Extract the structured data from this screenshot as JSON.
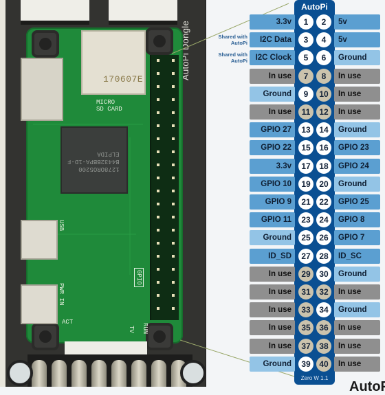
{
  "photo": {
    "dongle_label": "AutoPi Dongle",
    "sd_card_code": "170607E",
    "silkscreen": {
      "micro_sd": "MICRO\nSD CARD",
      "usb": "USB",
      "pwr_in": "PWR IN",
      "act": "ACT",
      "gpio": "GPIO",
      "tv": "TV",
      "run": "RUN",
      "soc_text": "1278ORO5200\nB4432BBPA-1D-F\nELPIDA"
    }
  },
  "pinout": {
    "title": "AutoPi",
    "footer": "Zero W 1.1",
    "shared_note": "Shared with AutoPi",
    "colors": {
      "column": "#0a4f92",
      "label_mid": "#5b9fd1",
      "label_light": "#93c4e6",
      "label_in_use": "#8f8f8f",
      "pin_free": "#ffffff",
      "pin_in_use": "#cbc3ad"
    },
    "rows": [
      {
        "left": {
          "pin": 1,
          "label": "3.3v",
          "style": "mid",
          "pin_style": "white"
        },
        "right": {
          "pin": 2,
          "label": "5v",
          "style": "mid",
          "pin_style": "white"
        },
        "note": ""
      },
      {
        "left": {
          "pin": 3,
          "label": "I2C Data",
          "style": "mid",
          "pin_style": "white"
        },
        "right": {
          "pin": 4,
          "label": "5v",
          "style": "mid",
          "pin_style": "white"
        },
        "note": "Shared with AutoPi"
      },
      {
        "left": {
          "pin": 5,
          "label": "I2C Clock",
          "style": "mid",
          "pin_style": "white"
        },
        "right": {
          "pin": 6,
          "label": "Ground",
          "style": "light",
          "pin_style": "white"
        },
        "note": "Shared with AutoPi"
      },
      {
        "left": {
          "pin": 7,
          "label": "In use",
          "style": "gray",
          "pin_style": "tan"
        },
        "right": {
          "pin": 8,
          "label": "In use",
          "style": "gray",
          "pin_style": "tan"
        },
        "note": ""
      },
      {
        "left": {
          "pin": 9,
          "label": "Ground",
          "style": "light",
          "pin_style": "white"
        },
        "right": {
          "pin": 10,
          "label": "In use",
          "style": "gray",
          "pin_style": "tan"
        },
        "note": ""
      },
      {
        "left": {
          "pin": 11,
          "label": "In use",
          "style": "gray",
          "pin_style": "tan"
        },
        "right": {
          "pin": 12,
          "label": "In use",
          "style": "gray",
          "pin_style": "tan"
        },
        "note": ""
      },
      {
        "left": {
          "pin": 13,
          "label": "GPIO 27",
          "style": "mid",
          "pin_style": "white"
        },
        "right": {
          "pin": 14,
          "label": "Ground",
          "style": "light",
          "pin_style": "white"
        },
        "note": ""
      },
      {
        "left": {
          "pin": 15,
          "label": "GPIO 22",
          "style": "mid",
          "pin_style": "white"
        },
        "right": {
          "pin": 16,
          "label": "GPIO 23",
          "style": "mid",
          "pin_style": "white"
        },
        "note": ""
      },
      {
        "left": {
          "pin": 17,
          "label": "3.3v",
          "style": "mid",
          "pin_style": "white"
        },
        "right": {
          "pin": 18,
          "label": "GPIO 24",
          "style": "mid",
          "pin_style": "white"
        },
        "note": ""
      },
      {
        "left": {
          "pin": 19,
          "label": "GPIO 10",
          "style": "mid",
          "pin_style": "white"
        },
        "right": {
          "pin": 20,
          "label": "Ground",
          "style": "light",
          "pin_style": "white"
        },
        "note": ""
      },
      {
        "left": {
          "pin": 21,
          "label": "GPIO 9",
          "style": "mid",
          "pin_style": "white"
        },
        "right": {
          "pin": 22,
          "label": "GPIO 25",
          "style": "mid",
          "pin_style": "white"
        },
        "note": ""
      },
      {
        "left": {
          "pin": 23,
          "label": "GPIO 11",
          "style": "mid",
          "pin_style": "white"
        },
        "right": {
          "pin": 24,
          "label": "GPIO 8",
          "style": "mid",
          "pin_style": "white"
        },
        "note": ""
      },
      {
        "left": {
          "pin": 25,
          "label": "Ground",
          "style": "light",
          "pin_style": "white"
        },
        "right": {
          "pin": 26,
          "label": "GPIO 7",
          "style": "mid",
          "pin_style": "white"
        },
        "note": ""
      },
      {
        "left": {
          "pin": 27,
          "label": "ID_SD",
          "style": "mid",
          "pin_style": "white"
        },
        "right": {
          "pin": 28,
          "label": "ID_SC",
          "style": "mid",
          "pin_style": "white"
        },
        "note": ""
      },
      {
        "left": {
          "pin": 29,
          "label": "In use",
          "style": "gray",
          "pin_style": "tan"
        },
        "right": {
          "pin": 30,
          "label": "Ground",
          "style": "light",
          "pin_style": "white"
        },
        "note": ""
      },
      {
        "left": {
          "pin": 31,
          "label": "In use",
          "style": "gray",
          "pin_style": "tan"
        },
        "right": {
          "pin": 32,
          "label": "In use",
          "style": "gray",
          "pin_style": "tan"
        },
        "note": ""
      },
      {
        "left": {
          "pin": 33,
          "label": "In use",
          "style": "gray",
          "pin_style": "tan"
        },
        "right": {
          "pin": 34,
          "label": "Ground",
          "style": "light",
          "pin_style": "white"
        },
        "note": ""
      },
      {
        "left": {
          "pin": 35,
          "label": "In use",
          "style": "gray",
          "pin_style": "tan"
        },
        "right": {
          "pin": 36,
          "label": "In use",
          "style": "gray",
          "pin_style": "tan"
        },
        "note": ""
      },
      {
        "left": {
          "pin": 37,
          "label": "In use",
          "style": "gray",
          "pin_style": "tan"
        },
        "right": {
          "pin": 38,
          "label": "In use",
          "style": "gray",
          "pin_style": "tan"
        },
        "note": ""
      },
      {
        "left": {
          "pin": 39,
          "label": "Ground",
          "style": "light",
          "pin_style": "white"
        },
        "right": {
          "pin": 40,
          "label": "In use",
          "style": "gray",
          "pin_style": "tan"
        },
        "note": ""
      }
    ]
  },
  "caption": "AutoPi"
}
